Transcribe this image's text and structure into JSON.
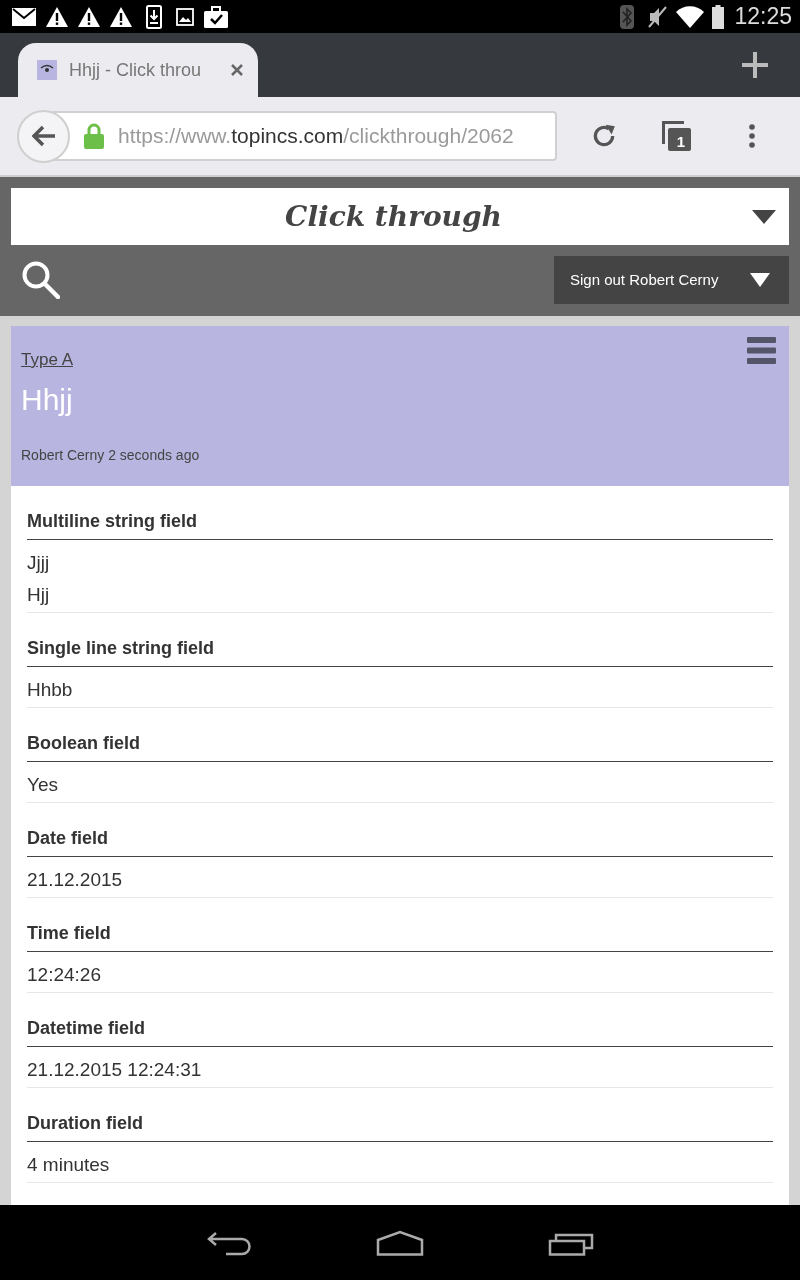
{
  "status_bar": {
    "time": "12:25"
  },
  "browser": {
    "tab": {
      "title": "Hhjj - Click throu"
    },
    "address": {
      "prefix": "https://www.",
      "domain": "topincs.com",
      "path": "/clickthrough/2062"
    },
    "tab_count": "1"
  },
  "header": {
    "title": "Click through",
    "sign_out": "Sign out Robert Cerny"
  },
  "record": {
    "type": "Type A",
    "title": "Hhjj",
    "byline": "Robert Cerny 2 seconds ago"
  },
  "fields": [
    {
      "label": "Multiline string field",
      "values": [
        "Jjjj",
        "Hjj"
      ]
    },
    {
      "label": "Single line string field",
      "values": [
        "Hhbb"
      ]
    },
    {
      "label": "Boolean field",
      "values": [
        "Yes"
      ]
    },
    {
      "label": "Date field",
      "values": [
        "21.12.2015"
      ]
    },
    {
      "label": "Time field",
      "values": [
        "12:24:26"
      ]
    },
    {
      "label": "Datetime field",
      "values": [
        "21.12.2015 12:24:31"
      ]
    },
    {
      "label": "Duration field",
      "values": [
        "4 minutes"
      ]
    }
  ]
}
